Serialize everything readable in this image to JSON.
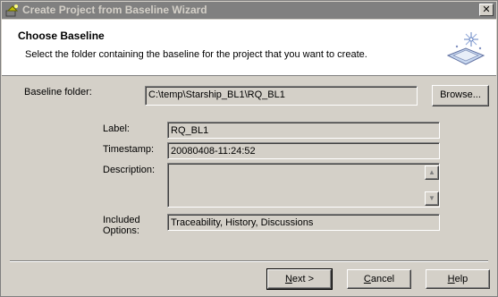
{
  "window": {
    "title": "Create Project from Baseline Wizard",
    "close_glyph": "✕"
  },
  "header": {
    "heading": "Choose Baseline",
    "subtext": "Select the folder containing the baseline for the project that you want to create."
  },
  "baseline_folder": {
    "label": "Baseline folder:",
    "value": "C:\\temp\\Starship_BL1\\RQ_BL1",
    "browse_label": "Browse..."
  },
  "details": {
    "label_label": "Label:",
    "label_value": "RQ_BL1",
    "timestamp_label": "Timestamp:",
    "timestamp_value": "20080408-11:24:52",
    "description_label": "Description:",
    "description_value": "",
    "included_options_label_line1": "Included",
    "included_options_label_line2": "Options:",
    "included_options_value": "Traceability, History, Discussions"
  },
  "footer": {
    "next_label": "ext >",
    "next_mnemonic": "N",
    "cancel_label": "ancel",
    "cancel_mnemonic": "C",
    "help_label": "elp",
    "help_mnemonic": "H"
  },
  "icons": {
    "app": "wizard-app-icon",
    "header": "wizard-sparkle-icon"
  }
}
